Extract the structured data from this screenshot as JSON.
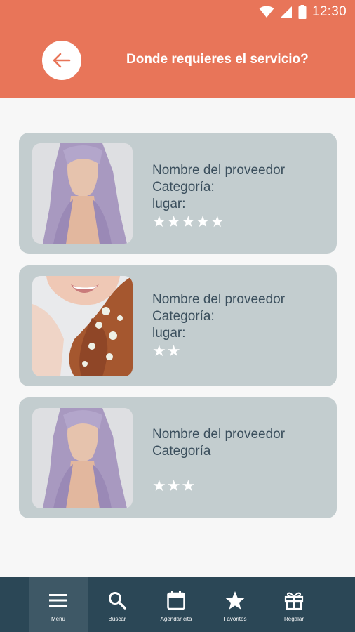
{
  "status_bar": {
    "time": "12:30"
  },
  "header": {
    "title": "Donde requieres el servicio?"
  },
  "providers": [
    {
      "name": "Nombre del proveedor",
      "category": "Categoría:",
      "location": "lugar:",
      "rating": 5,
      "stars": "★★★★★"
    },
    {
      "name": "Nombre del proveedor",
      "category": "Categoría:",
      "location": "lugar:",
      "rating": 2,
      "stars": "★★"
    },
    {
      "name": "Nombre del proveedor",
      "category": "Categoría",
      "location": "",
      "rating": 3,
      "stars": "★★★"
    }
  ],
  "bottom_nav": {
    "items": [
      {
        "label": "Menú",
        "icon": "menu-icon",
        "active": true
      },
      {
        "label": "Buscar",
        "icon": "search-icon",
        "active": false
      },
      {
        "label": "Agendar cita",
        "icon": "calendar-icon",
        "active": false
      },
      {
        "label": "Favoritos",
        "icon": "star-icon",
        "active": false
      },
      {
        "label": "Regalar",
        "icon": "gift-icon",
        "active": false
      }
    ]
  },
  "colors": {
    "header": "#e87559",
    "card": "#c3cdcf",
    "nav": "#2b4756",
    "nav_active": "#3e5866",
    "text": "#3b4f5d"
  }
}
